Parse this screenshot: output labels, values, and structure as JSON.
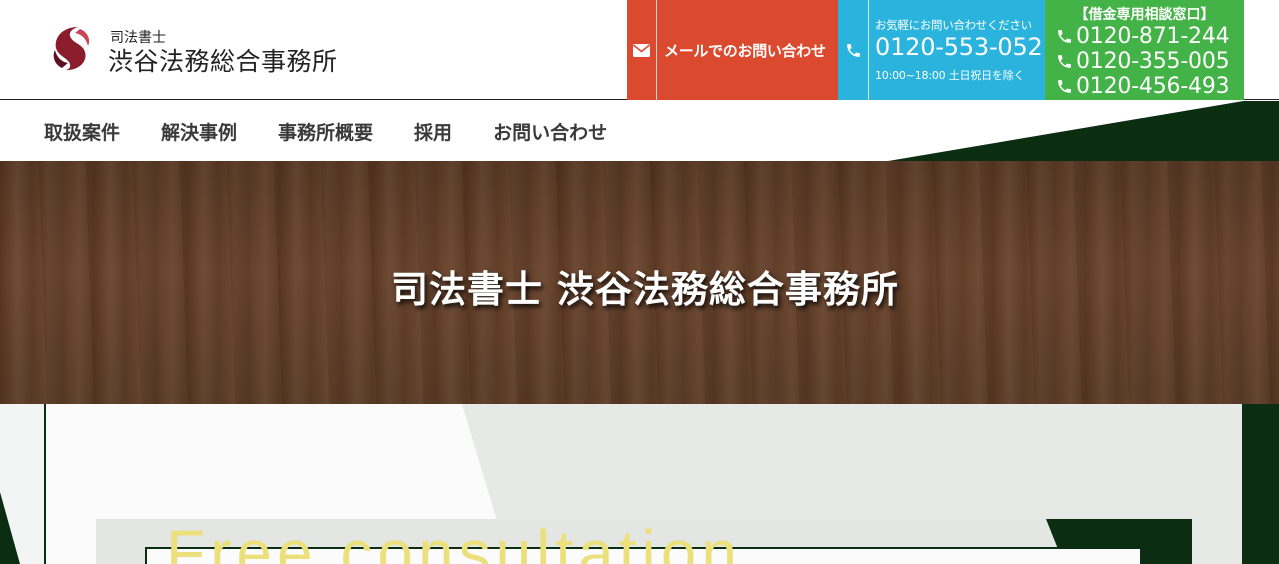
{
  "header": {
    "brand_sub": "司法書士",
    "brand_main": "渋谷法務総合事務所",
    "mail_button": "メールでのお問い合わせ",
    "tel_caption": "お気軽にお問い合わせください",
    "tel_number": "0120-553-052",
    "tel_hours": "10:00~18:00 土日祝日を除く",
    "debt_title": "【借金専用相談窓口】",
    "debt_numbers": [
      "0120-871-244",
      "0120-355-005",
      "0120-456-493"
    ]
  },
  "nav": {
    "items": [
      "取扱案件",
      "解決事例",
      "事務所概要",
      "採用",
      "お問い合わせ"
    ]
  },
  "hero": {
    "title": "司法書士 渋谷法務総合事務所"
  },
  "lower": {
    "heading_en": "Free consultation"
  },
  "colors": {
    "mail": "#db4a2e",
    "tel": "#2ab4dd",
    "debt": "#44b347",
    "dark_green": "#0b2d12",
    "accent_yellow": "#ece07c"
  },
  "icons": {
    "logo": "logo-mark",
    "mail": "envelope-icon",
    "tel": "phone-icon"
  }
}
